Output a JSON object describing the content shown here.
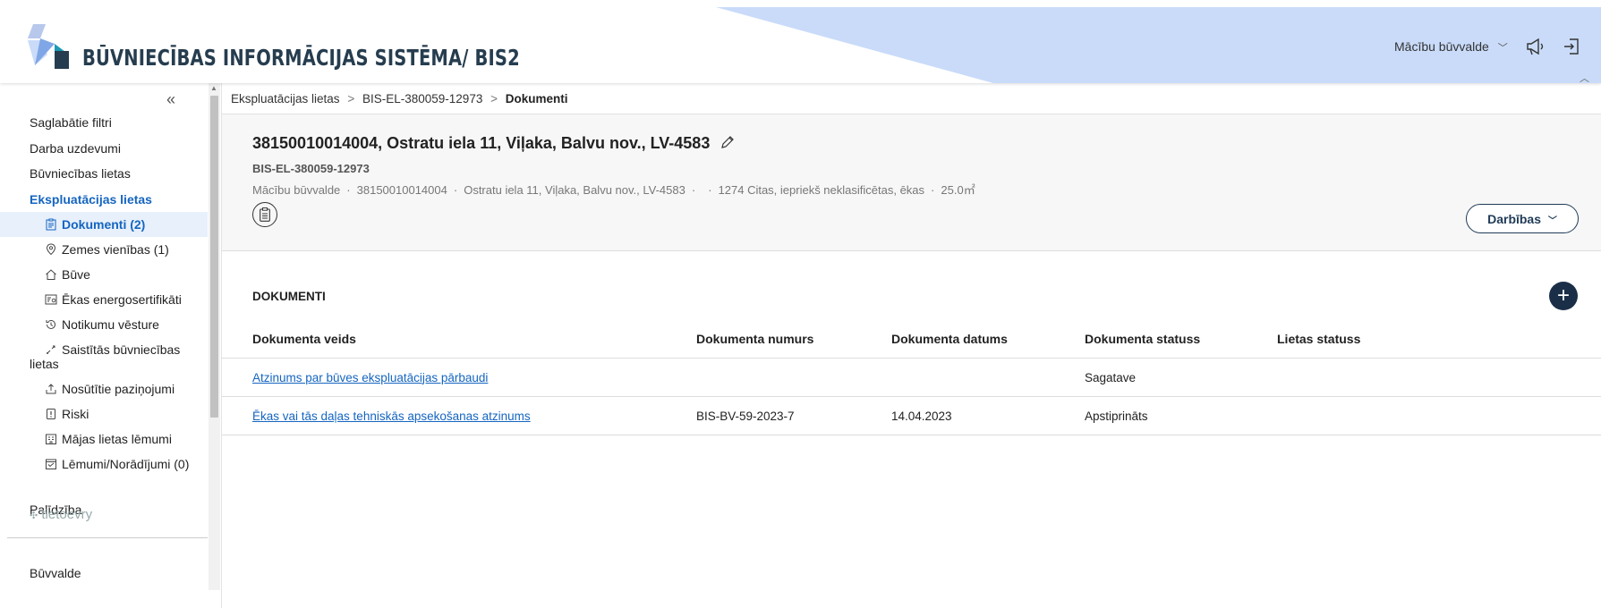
{
  "header": {
    "title": "BŪVNIECĪBAS INFORMĀCIJAS SISTĒMA/ BIS2",
    "org": "Mācību būvvalde",
    "colors": {
      "accent_band": "#c9dbf9",
      "brand_dark": "#263d4f",
      "brand_teal": "#1c9bb5"
    }
  },
  "sidebar": {
    "items": [
      {
        "label": "Saglabātie filtri"
      },
      {
        "label": "Darba uzdevumi"
      },
      {
        "label": "Būvniecības lietas"
      },
      {
        "label": "Ekspluatācijas lietas"
      }
    ],
    "sub_items": [
      {
        "label": "Dokumenti (2)",
        "icon": "clipboard-icon"
      },
      {
        "label": "Zemes vienības (1)",
        "icon": "location-pin-icon"
      },
      {
        "label": "Būve",
        "icon": "house-icon"
      },
      {
        "label": "Ēkas energosertifikāti",
        "icon": "energy-certificate-icon"
      },
      {
        "label": "Notikumu vēsture",
        "icon": "history-icon"
      },
      {
        "label": "Saistītās būvniecības lietas",
        "icon": "link-icon"
      },
      {
        "label": "Nosūtītie paziņojumi",
        "icon": "upload-icon"
      },
      {
        "label": "Riski",
        "icon": "alert-icon"
      },
      {
        "label": "Mājas lietas lēmumi",
        "icon": "building-icon"
      },
      {
        "label": "Lēmumi/Norādījumi (0)",
        "icon": "decision-icon"
      }
    ],
    "help": "Palīdzība",
    "bottom_label": "Būvvalde",
    "vendor": "tietoevry"
  },
  "breadcrumb": {
    "items": [
      "Ekspluatācijas lietas",
      "BIS-EL-380059-12973",
      "Dokumenti"
    ],
    "separator": ">"
  },
  "case": {
    "title": "38150010014004, Ostratu iela 11, Viļaka, Balvu nov., LV-4583",
    "id": "BIS-EL-380059-12973",
    "meta": [
      "Mācību būvvalde",
      "38150010014004",
      "Ostratu iela 11, Viļaka, Balvu nov., LV-4583",
      "",
      "1274 Citas, iepriekš neklasificētas, ēkas",
      "25.0㎡"
    ],
    "actions_label": "Darbības"
  },
  "documents": {
    "section_title": "DOKUMENTI",
    "add_label": "+",
    "columns": [
      "Dokumenta veids",
      "Dokumenta numurs",
      "Dokumenta datums",
      "Dokumenta statuss",
      "Lietas statuss"
    ],
    "rows": [
      {
        "type": "Atzinums par būves ekspluatācijas pārbaudi",
        "number": "",
        "date": "",
        "status": "Sagatave",
        "case_status": ""
      },
      {
        "type": "Ēkas vai tās daļas tehniskās apsekošanas atzinums",
        "number": "BIS-BV-59-2023-7",
        "date": "14.04.2023",
        "status": "Apstiprināts",
        "case_status": ""
      }
    ]
  }
}
